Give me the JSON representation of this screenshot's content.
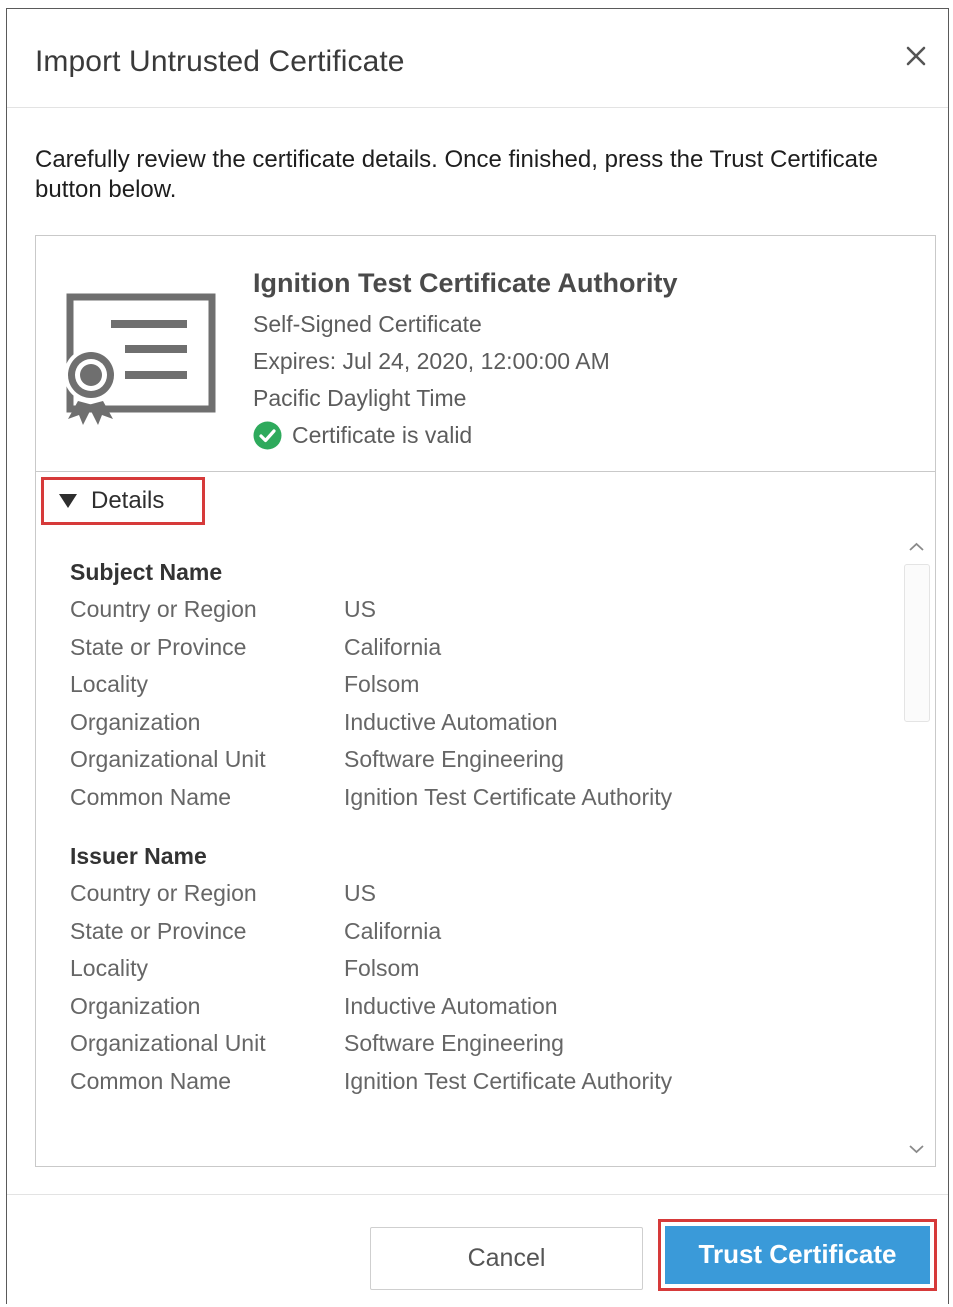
{
  "dialog": {
    "title": "Import Untrusted Certificate",
    "intro": "Carefully review the certificate details. Once finished, press the Trust Certificate button below."
  },
  "summary": {
    "name": "Ignition Test Certificate Authority",
    "type": "Self-Signed Certificate",
    "expires": "Expires: Jul 24, 2020, 12:00:00 AM",
    "timezone": "Pacific Daylight Time",
    "status": "Certificate is valid",
    "status_color": "#2eaa5c",
    "icon": "certificate-icon"
  },
  "details": {
    "toggle_label": "Details",
    "subject": {
      "title": "Subject Name",
      "rows": [
        {
          "key": "Country or Region",
          "value": "US"
        },
        {
          "key": "State or Province",
          "value": "California"
        },
        {
          "key": "Locality",
          "value": "Folsom"
        },
        {
          "key": "Organization",
          "value": "Inductive Automation"
        },
        {
          "key": "Organizational Unit",
          "value": "Software Engineering"
        },
        {
          "key": "Common Name",
          "value": "Ignition Test Certificate Authority"
        }
      ]
    },
    "issuer": {
      "title": "Issuer Name",
      "rows": [
        {
          "key": "Country or Region",
          "value": "US"
        },
        {
          "key": "State or Province",
          "value": "California"
        },
        {
          "key": "Locality",
          "value": "Folsom"
        },
        {
          "key": "Organization",
          "value": "Inductive Automation"
        },
        {
          "key": "Organizational Unit",
          "value": "Software Engineering"
        },
        {
          "key": "Common Name",
          "value": "Ignition Test Certificate Authority"
        }
      ]
    }
  },
  "footer": {
    "cancel_label": "Cancel",
    "trust_label": "Trust Certificate",
    "accent": "#3a9ad9",
    "highlight": "#d63a3a"
  }
}
